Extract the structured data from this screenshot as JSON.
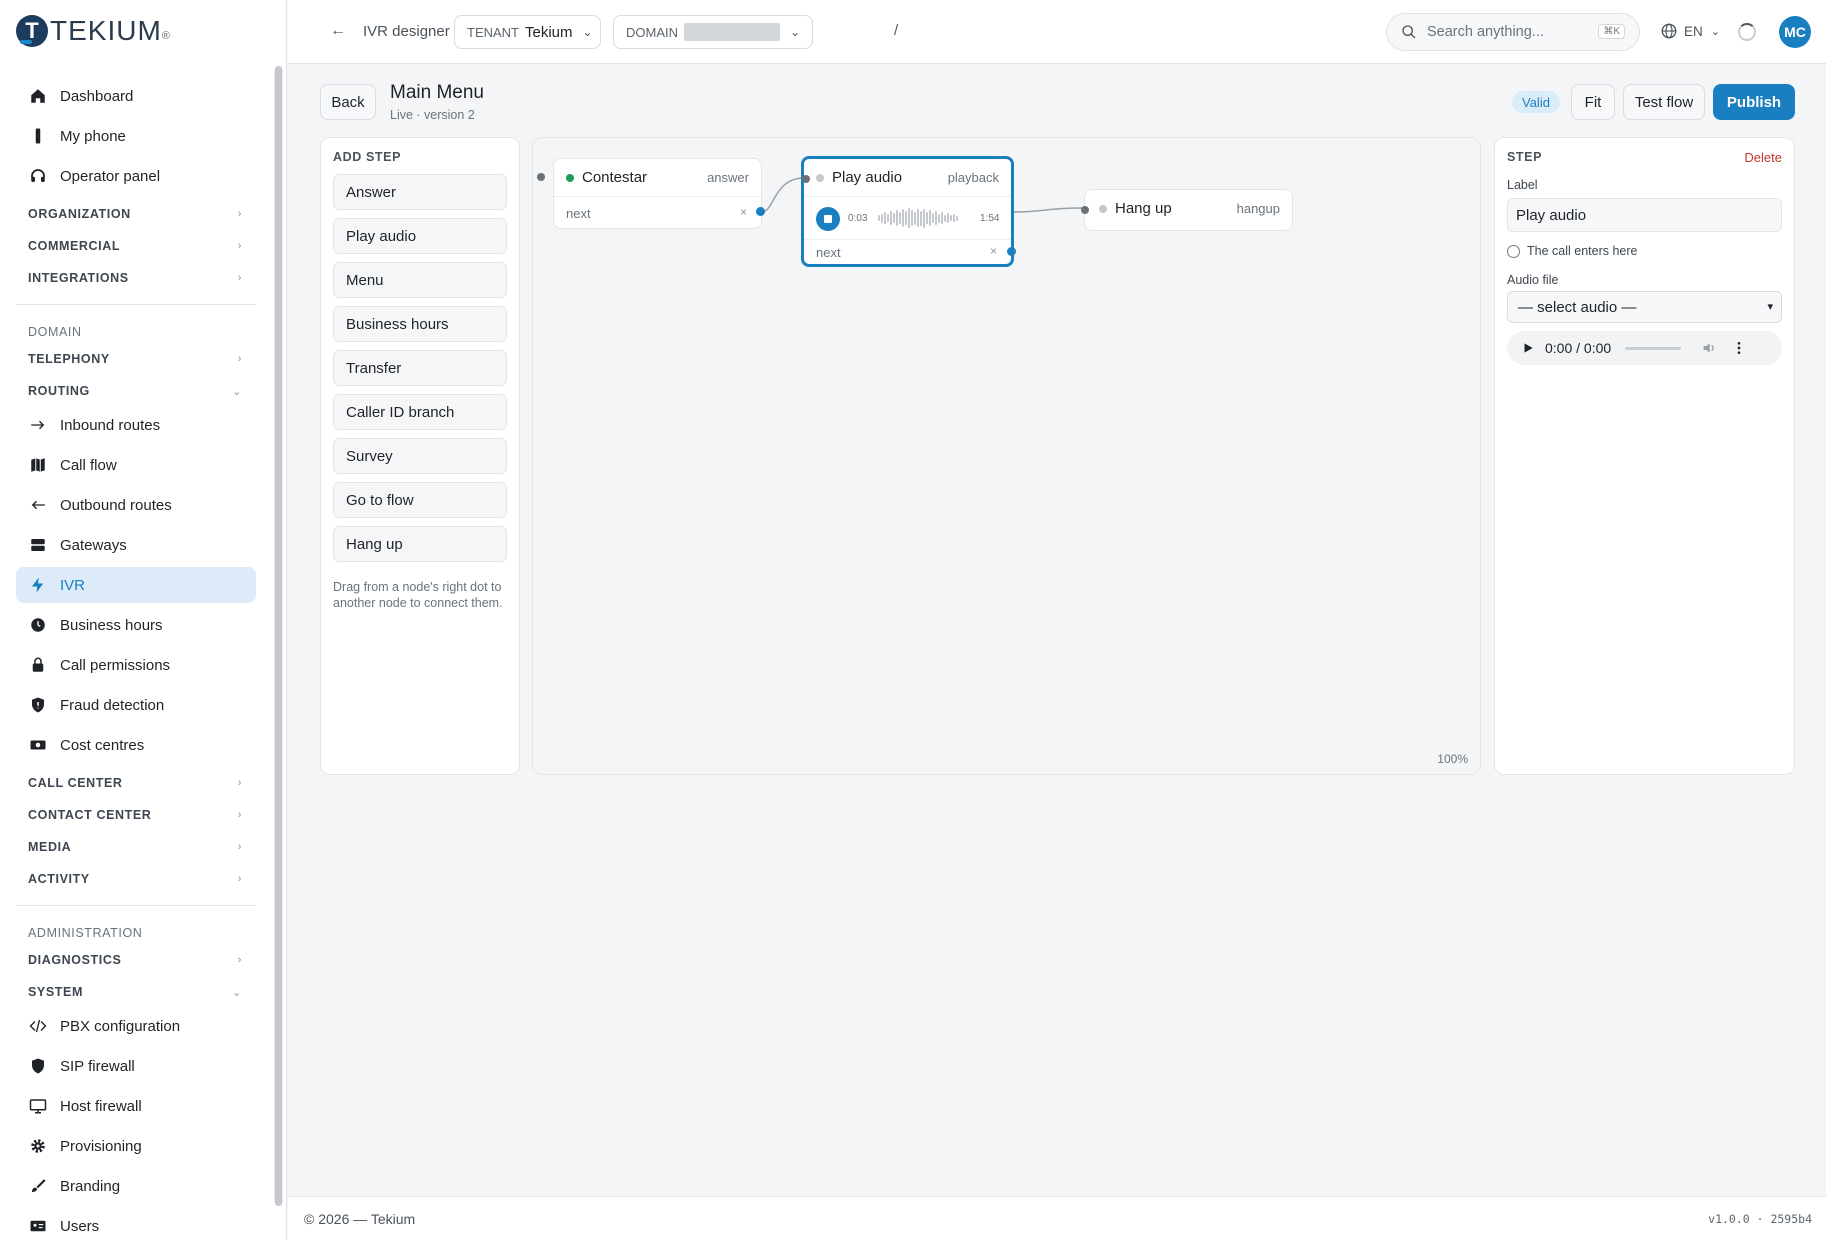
{
  "brand": {
    "name": "TEKIUM",
    "mark": "T"
  },
  "sidebar": {
    "top_items": [
      {
        "label": "Dashboard",
        "icon": "home-icon"
      },
      {
        "label": "My phone",
        "icon": "phone-icon"
      },
      {
        "label": "Operator panel",
        "icon": "headset-icon"
      }
    ],
    "groups_1": [
      "ORGANIZATION",
      "COMMERCIAL",
      "INTEGRATIONS"
    ],
    "section_domain": "DOMAIN",
    "telephony": "TELEPHONY",
    "routing": "ROUTING",
    "routing_items": [
      {
        "label": "Inbound routes",
        "icon": "arrow-right-icon"
      },
      {
        "label": "Call flow",
        "icon": "map-icon"
      },
      {
        "label": "Outbound routes",
        "icon": "arrow-left-icon"
      },
      {
        "label": "Gateways",
        "icon": "server-icon"
      },
      {
        "label": "IVR",
        "icon": "bolt-icon",
        "active": true
      },
      {
        "label": "Business hours",
        "icon": "clock-icon"
      },
      {
        "label": "Call permissions",
        "icon": "lock-icon"
      },
      {
        "label": "Fraud detection",
        "icon": "shield-alert-icon"
      },
      {
        "label": "Cost centres",
        "icon": "money-icon"
      }
    ],
    "groups_2": [
      "CALL CENTER",
      "CONTACT CENTER",
      "MEDIA",
      "ACTIVITY"
    ],
    "section_admin": "ADMINISTRATION",
    "diagnostics": "DIAGNOSTICS",
    "system": "SYSTEM",
    "system_items": [
      {
        "label": "PBX configuration",
        "icon": "code-icon"
      },
      {
        "label": "SIP firewall",
        "icon": "shield-icon"
      },
      {
        "label": "Host firewall",
        "icon": "monitor-icon"
      },
      {
        "label": "Provisioning",
        "icon": "gear-icon"
      },
      {
        "label": "Branding",
        "icon": "brush-icon"
      },
      {
        "label": "Users",
        "icon": "id-card-icon"
      }
    ]
  },
  "topbar": {
    "crumb": "IVR designer",
    "tenant_label": "TENANT",
    "tenant_value": "Tekium",
    "domain_label": "DOMAIN",
    "separator": "/",
    "search_placeholder": "Search anything...",
    "search_shortcut": "⌘K",
    "language": "EN",
    "avatar_initials": "MC"
  },
  "page": {
    "back_label": "Back",
    "title": "Main Menu",
    "subtitle": "Live · version 2",
    "status_badge": "Valid",
    "fit_label": "Fit",
    "test_label": "Test flow",
    "publish_label": "Publish"
  },
  "add_step": {
    "heading": "ADD STEP",
    "steps": [
      "Answer",
      "Play audio",
      "Menu",
      "Business hours",
      "Transfer",
      "Caller ID branch",
      "Survey",
      "Go to flow",
      "Hang up"
    ],
    "hint": "Drag from a node's right dot to another node to connect them."
  },
  "canvas": {
    "zoom": "100%",
    "nodes": {
      "answer": {
        "name": "Contestar",
        "type": "answer",
        "output": "next",
        "status_color": "#1f9d55"
      },
      "playback": {
        "name": "Play audio",
        "type": "playback",
        "output": "next",
        "time_elapsed": "0:03",
        "time_total": "1:54",
        "status_color": "#c5c9ce"
      },
      "hangup": {
        "name": "Hang up",
        "type": "hangup",
        "status_color": "#c5c9ce"
      }
    },
    "remove_glyph": "×"
  },
  "inspector": {
    "heading": "STEP",
    "delete_label": "Delete",
    "label_field": "Label",
    "label_value": "Play audio",
    "entry_option": "The call enters here",
    "audio_field": "Audio file",
    "audio_select_value": "— select audio —",
    "player_time": "0:00 / 0:00"
  },
  "footer": {
    "copyright": "© 2026 — Tekium",
    "version": "v1.0.0 · 2595b4"
  },
  "colors": {
    "accent": "#1a7fc1",
    "active_bg": "#dcebf7",
    "delete": "#c0392b",
    "success": "#1f9d55"
  }
}
